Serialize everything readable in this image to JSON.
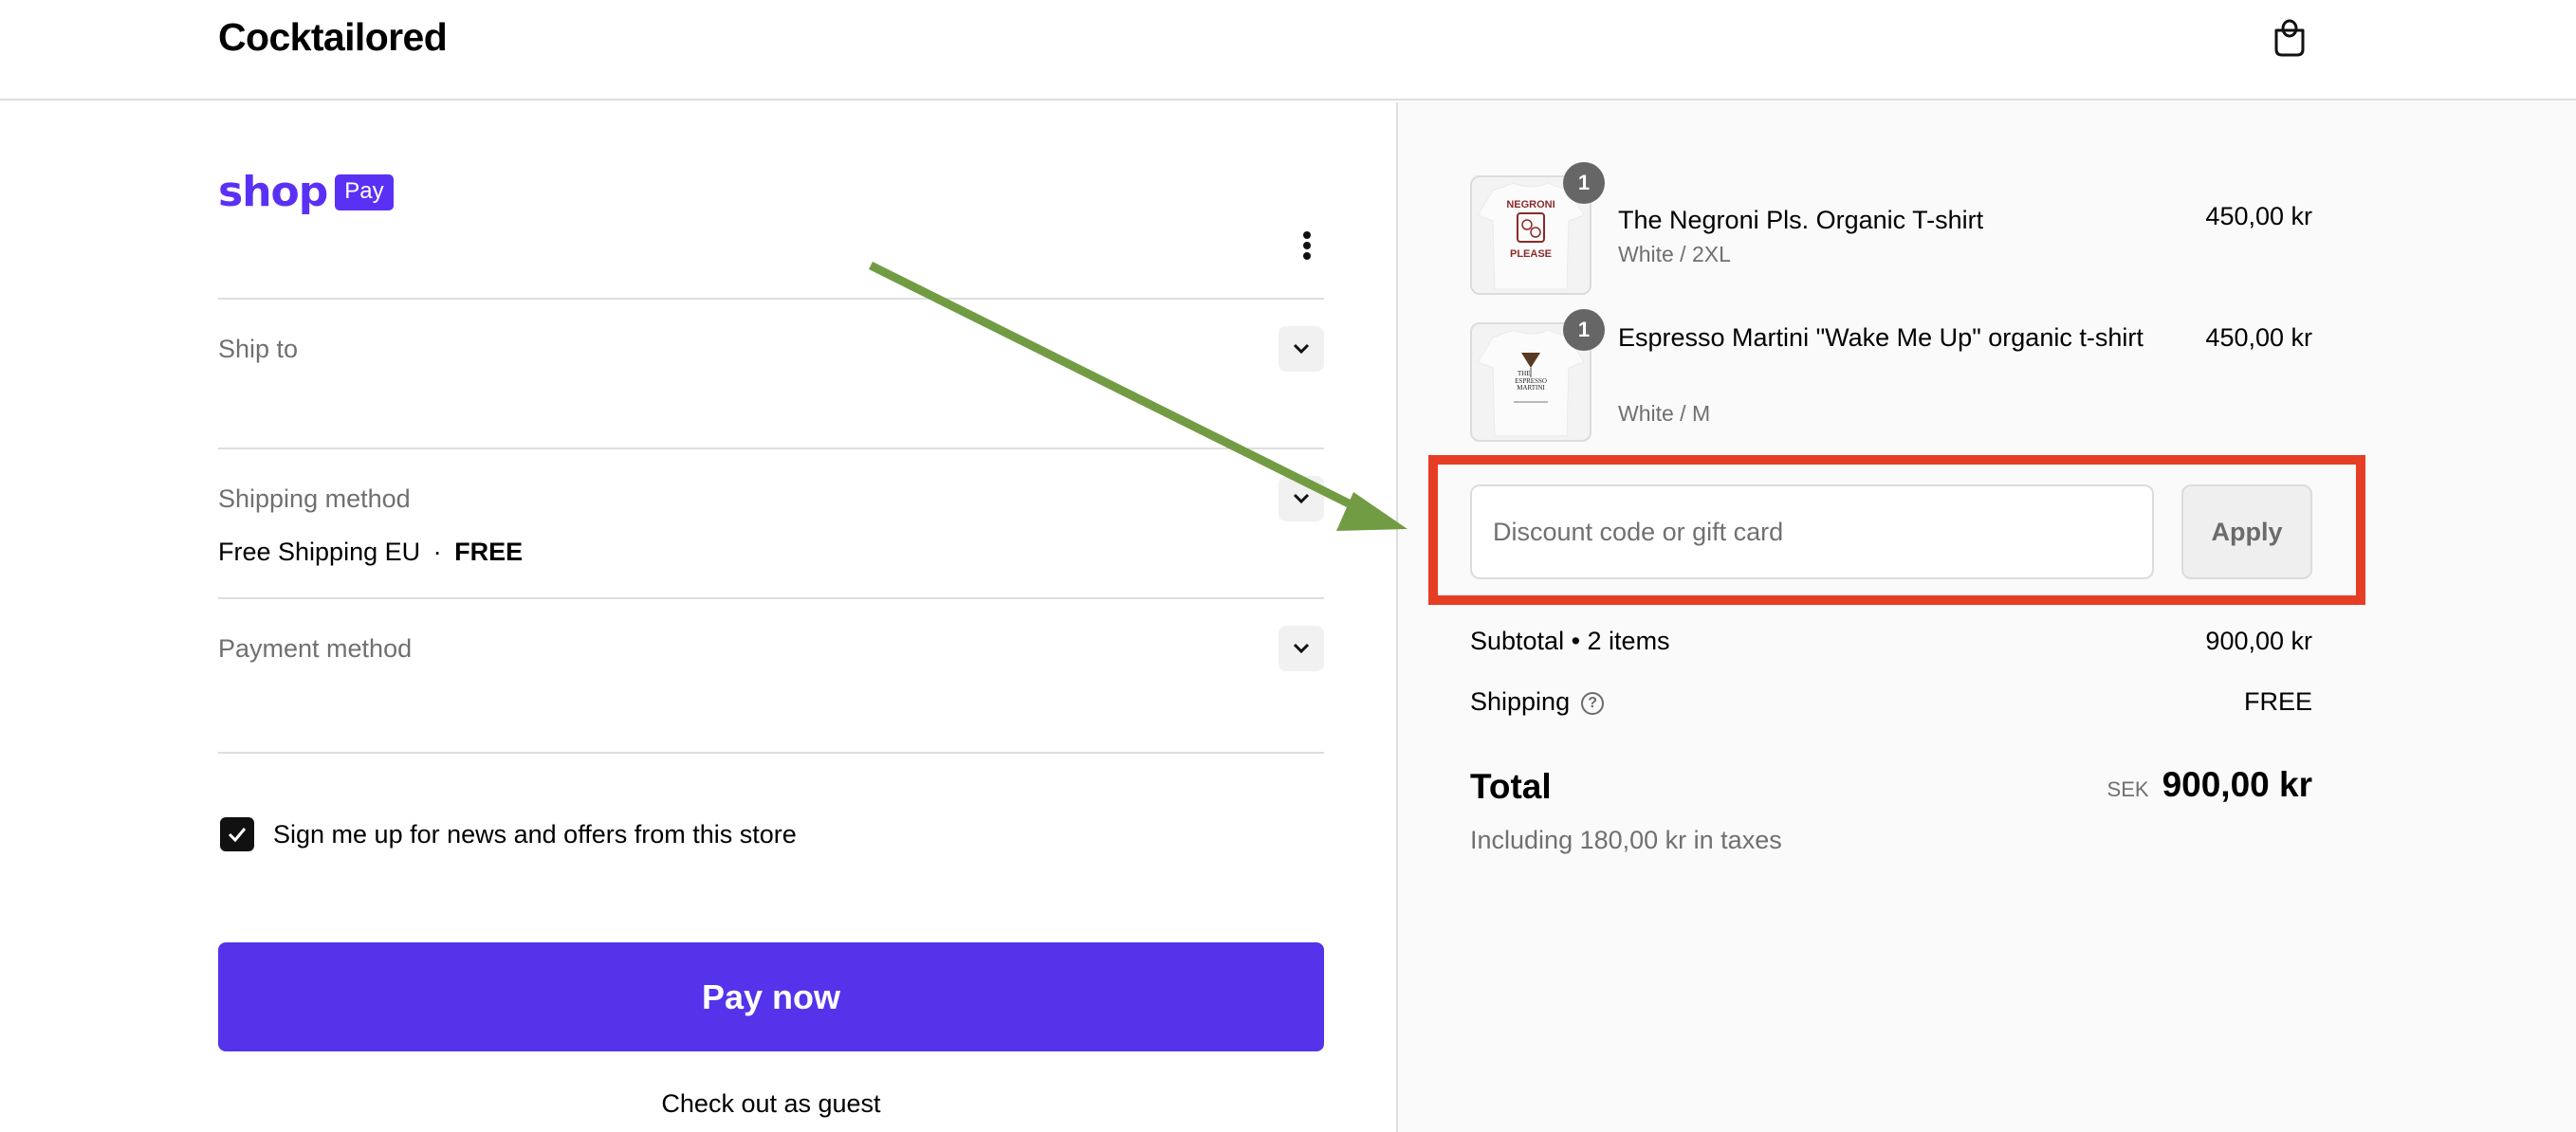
{
  "header": {
    "store_name": "Cocktailored",
    "cart_icon": "shopping-bag-icon"
  },
  "express": {
    "brand_word": "shop",
    "brand_badge": "Pay",
    "menu_icon": "more-vertical-icon",
    "brand_color": "#5a31f4"
  },
  "sections": [
    {
      "label": "Ship to",
      "value": ""
    },
    {
      "label": "Shipping method",
      "value": "Free Shipping EU",
      "separator": "·",
      "price": "FREE"
    },
    {
      "label": "Payment method",
      "value": ""
    }
  ],
  "newsletter": {
    "label": "Sign me up for news and offers from this store",
    "checked": true
  },
  "actions": {
    "pay_now": "Pay now",
    "pay_now_color": "#5433eb",
    "guest": "Check out as guest"
  },
  "cart": {
    "items": [
      {
        "title": "The Negroni Pls. Organic T-shirt",
        "variant": "White / 2XL",
        "price": "450,00 kr",
        "quantity": "1",
        "image": "negroni-tshirt-image"
      },
      {
        "title": "Espresso Martini \"Wake Me Up\" organic t-shirt",
        "variant": "White / M",
        "price": "450,00 kr",
        "quantity": "1",
        "image": "espresso-martini-tshirt-image"
      }
    ]
  },
  "discount": {
    "placeholder": "Discount code or gift card",
    "value": "",
    "apply_label": "Apply"
  },
  "totals": {
    "subtotal_label": "Subtotal • 2 items",
    "subtotal_value": "900,00 kr",
    "shipping_label": "Shipping",
    "shipping_value": "FREE",
    "total_label": "Total",
    "currency": "SEK",
    "total_value": "900,00 kr",
    "tax_note": "Including 180,00 kr in taxes"
  },
  "annotation": {
    "highlight_color": "#e63e24",
    "arrow_color": "#729c44"
  }
}
